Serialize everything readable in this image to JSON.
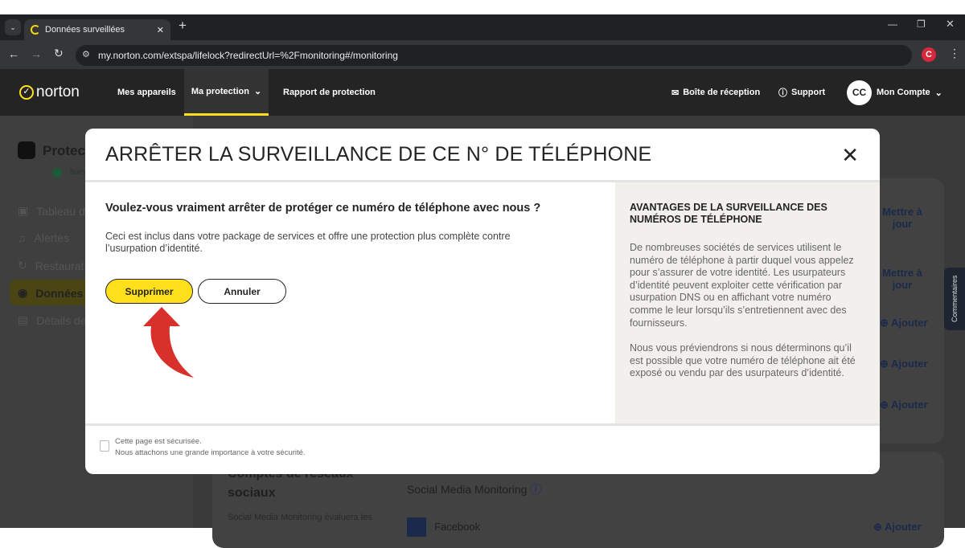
{
  "browser": {
    "tab_title": "Données surveillées",
    "url": "my.norton.com/extspa/lifelock?redirectUrl=%2Fmonitoring#/monitoring"
  },
  "nav": {
    "logo": "norton",
    "items": [
      "Mes appareils",
      "Ma protection",
      "Rapport de protection"
    ],
    "active": "Ma protection",
    "inbox": "Boîte de réception",
    "support": "Support",
    "avatar": "CC",
    "account": "Mon Compte"
  },
  "sidebar": {
    "title": "Protect",
    "status": "Surv",
    "items": [
      {
        "label": "Tableau d",
        "icon": "dashboard-icon"
      },
      {
        "label": "Alertes",
        "icon": "bell-icon"
      },
      {
        "label": "Restaurat",
        "icon": "restore-icon"
      },
      {
        "label": "Données",
        "icon": "eye-icon",
        "active": true
      },
      {
        "label": "Détails de",
        "icon": "id-icon"
      }
    ]
  },
  "background": {
    "actions": [
      "Mettre à jour",
      "Mettre à jour",
      "Ajouter",
      "Ajouter",
      "Ajouter"
    ],
    "section_title": "Comptes de réseaux sociaux",
    "section_desc": "Social Media Monitoring évaluera les",
    "smm_title": "Social Media Monitoring",
    "facebook": "Facebook",
    "bottom_action": "Ajouter",
    "feedback": "Commentaires"
  },
  "modal": {
    "title": "ARRÊTER LA SURVEILLANCE DE CE N° DE TÉLÉPHONE",
    "question": "Voulez-vous vraiment arrêter de protéger ce numéro de téléphone avec nous ?",
    "description": "Ceci est inclus dans votre package de services et offre une protection plus complète contre l’usurpation d’identité.",
    "confirm": "Supprimer",
    "cancel": "Annuler",
    "side_title": "AVANTAGES DE LA SURVEILLANCE DES NUMÉROS DE TÉLÉPHONE",
    "side_p1": "De nombreuses sociétés de services utilisent le numéro de téléphone à partir duquel vous appelez pour s’assurer de votre identité. Les usurpateurs d’identité peuvent exploiter cette vérification par usurpation DNS ou en affichant votre numéro comme le leur lorsqu’ils s’entretiennent avec des fournisseurs.",
    "side_p2": "Nous vous préviendrons si nous déterminons qu’il est possible que votre numéro de téléphone ait été exposé ou vendu par des usurpateurs d’identité.",
    "footer_1": "Cette page est sécurisée.",
    "footer_2": "Nous attachons une grande importance à votre sécurité."
  },
  "colors": {
    "accent": "#ffe01b",
    "arrow": "#d8312c",
    "nav_bg": "#242424"
  }
}
